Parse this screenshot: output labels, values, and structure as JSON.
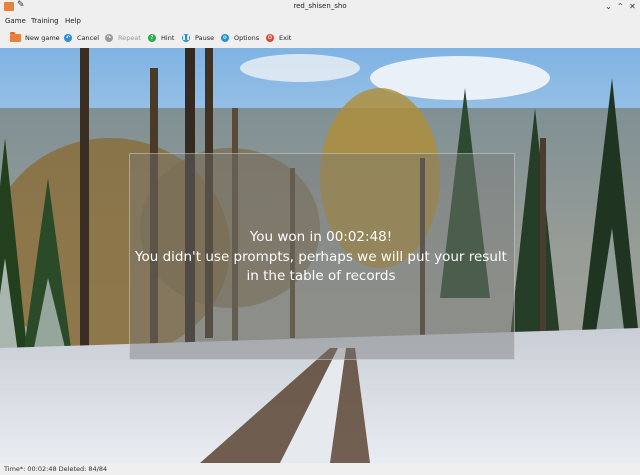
{
  "window": {
    "title": "red_shisen_sho"
  },
  "menu": [
    "Game",
    "Training",
    "Help"
  ],
  "toolbar": {
    "new_game": "New game",
    "cancel": "Cancel",
    "repeat": "Repeat",
    "hint": "Hint",
    "pause": "Pause",
    "options": "Options",
    "exit": "Exit"
  },
  "message": {
    "line1": "You won in 00:02:48!",
    "line2": "You didn't use prompts, perhaps we will put your result",
    "line3": "in the table of records"
  },
  "status": {
    "text": "Time*: 00:02:48  Deleted: 84/84"
  },
  "colors": {
    "accent": "#e8823a",
    "cancel": "#2a8fd8",
    "repeat": "#9a9a9a",
    "hint": "#26b04a",
    "pause": "#2a8fd8",
    "options": "#2a8fd8",
    "exit": "#e0452f"
  }
}
